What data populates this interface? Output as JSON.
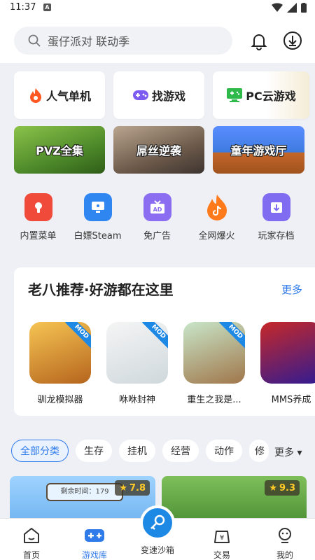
{
  "status_bar": {
    "time": "11:37"
  },
  "search": {
    "placeholder": "蛋仔派对 联动季"
  },
  "quick_cards": [
    {
      "label": "人气单机",
      "icon": "fire-icon"
    },
    {
      "label": "找游戏",
      "icon": "gamepad-icon"
    },
    {
      "label": "PC云游戏",
      "icon": "monitor-gamepad-icon"
    }
  ],
  "banners": [
    {
      "label": "PVZ全集"
    },
    {
      "label": "屌丝逆袭"
    },
    {
      "label": "童年游戏厅"
    }
  ],
  "tools": [
    {
      "label": "内置菜单",
      "icon": "menu-icon",
      "color": "#f04a3a"
    },
    {
      "label": "白嫖Steam",
      "icon": "monitor-icon",
      "color": "#2f86f0"
    },
    {
      "label": "免广告",
      "icon": "ad-block-icon",
      "color": "#8a6df0"
    },
    {
      "label": "全网爆火",
      "icon": "tiktok-fire-icon",
      "color": "#ff7a1a"
    },
    {
      "label": "玩家存档",
      "icon": "save-folder-icon",
      "color": "#7f6cf0"
    }
  ],
  "recommend": {
    "title": "老八推荐·好游都在这里",
    "more_label": "更多",
    "games": [
      {
        "name": "驯龙模拟器",
        "badge": "MOD"
      },
      {
        "name": "咻咻封神",
        "badge": "MOD"
      },
      {
        "name": "重生之我是...",
        "badge": "MOD"
      },
      {
        "name": "MMS养成",
        "badge": ""
      }
    ]
  },
  "categories": {
    "items": [
      "全部分类",
      "生存",
      "挂机",
      "经营",
      "动作",
      "修"
    ],
    "active_index": 0,
    "more_label": "更多"
  },
  "game_cards": [
    {
      "rating": "7.8",
      "timer_text": "剩余时间：179"
    },
    {
      "rating": "9.3"
    }
  ],
  "bottom_tabs": [
    {
      "label": "首页",
      "icon": "home-icon"
    },
    {
      "label": "游戏库",
      "icon": "gamepad-icon"
    },
    {
      "label": "变速沙箱",
      "icon": "sandbox-key-icon"
    },
    {
      "label": "交易",
      "icon": "trade-icon"
    },
    {
      "label": "我的",
      "icon": "profile-icon"
    }
  ],
  "active_tab": "游戏库",
  "colors": {
    "accent": "#2f7bea",
    "fab": "#1e88e5",
    "rating": "#ffca28"
  }
}
